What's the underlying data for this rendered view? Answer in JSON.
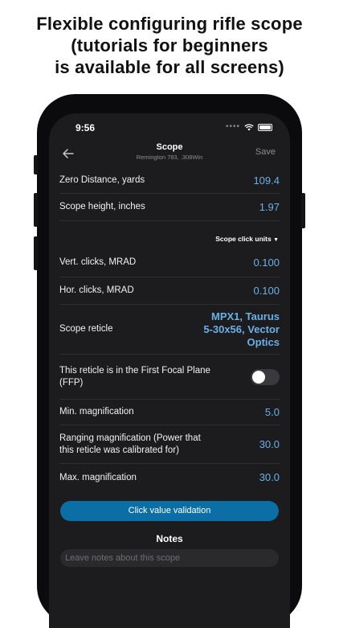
{
  "headline": [
    "Flexible configuring rifle scope",
    "(tutorials for beginners",
    "is available for all screens)"
  ],
  "status": {
    "time": "9:56"
  },
  "nav": {
    "title": "Scope",
    "subtitle": "Remington 783, .308Win",
    "save_label": "Save"
  },
  "rows": {
    "zero_distance": {
      "label": "Zero Distance, yards",
      "value": "109.4"
    },
    "scope_height": {
      "label": "Scope height, inches",
      "value": "1.97"
    },
    "click_units_label": "Scope click units",
    "vert_clicks": {
      "label": "Vert. clicks, MRAD",
      "value": "0.100"
    },
    "hor_clicks": {
      "label": "Hor. clicks, MRAD",
      "value": "0.100"
    },
    "reticle": {
      "label": "Scope reticle",
      "value": [
        "MPX1, Taurus",
        "5-30x56, Vector",
        "Optics"
      ]
    },
    "ffp": {
      "label": [
        "This reticle is in the First Focal Plane",
        "(FFP)"
      ],
      "on": false
    },
    "min_mag": {
      "label": "Min. magnification",
      "value": "5.0"
    },
    "ranging_mag": {
      "label": [
        "Ranging magnification (Power that",
        "this reticle was calibrated for)"
      ],
      "value": "30.0"
    },
    "max_mag": {
      "label": "Max. magnification",
      "value": "30.0"
    }
  },
  "validate_button": "Click value validation",
  "notes": {
    "title": "Notes",
    "placeholder": "Leave notes about this scope"
  },
  "colors": {
    "accent": "#6ab0e6",
    "button": "#0b6fa6",
    "screen_bg": "#1c1c1e"
  },
  "icons": [
    "back-arrow-icon",
    "wifi-icon",
    "battery-icon",
    "signal-dots-icon",
    "caret-down-icon"
  ]
}
